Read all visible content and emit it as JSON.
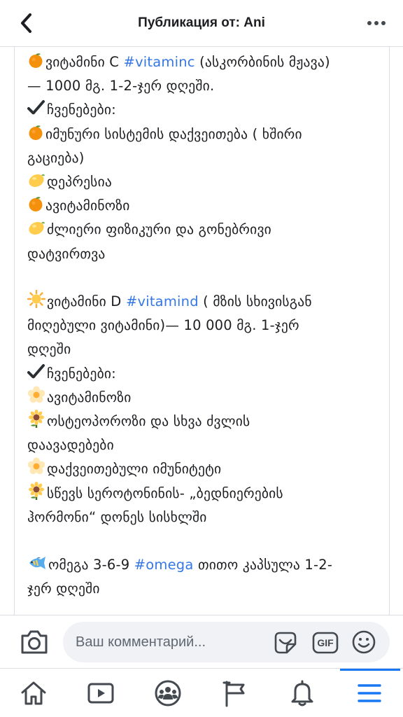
{
  "header": {
    "title": "Публикация от: Ani",
    "back_icon": "chevron-left-icon",
    "more_icon": "more-horizontal-icon"
  },
  "post": {
    "lines": [
      {
        "emoji": "orange",
        "parts": [
          {
            "text": "ვიტამინი C "
          },
          {
            "text": "#vitaminc",
            "tag": true
          },
          {
            "text": " (ასკორბინის მჟავა)"
          }
        ]
      },
      {
        "parts": [
          {
            "text": "— 1000 მგ. 1-2-ჯერ დღეში."
          }
        ]
      },
      {
        "emoji": "check",
        "parts": [
          {
            "text": "ჩვენებები:"
          }
        ]
      },
      {
        "emoji": "orange",
        "parts": [
          {
            "text": "იმუნური სისტემის დაქვეითება ( ხშირი"
          }
        ]
      },
      {
        "parts": [
          {
            "text": "გაციება)"
          }
        ]
      },
      {
        "emoji": "lemon",
        "parts": [
          {
            "text": "დეპრესია"
          }
        ]
      },
      {
        "emoji": "orange",
        "parts": [
          {
            "text": "ავიტამინოზი"
          }
        ]
      },
      {
        "emoji": "lemon",
        "parts": [
          {
            "text": "ძლიერი ფიზიკური და გონებრივი"
          }
        ]
      },
      {
        "parts": [
          {
            "text": "დატვირთვა"
          }
        ]
      },
      {
        "blank": true
      },
      {
        "emoji": "sun",
        "parts": [
          {
            "text": "ვიტამინი D "
          },
          {
            "text": "#vitamind",
            "tag": true
          },
          {
            "text": " ( მზის სხივისგან"
          }
        ]
      },
      {
        "parts": [
          {
            "text": "მიღებული ვიტამინი)— 10 000 მგ. 1-ჯერ"
          }
        ]
      },
      {
        "parts": [
          {
            "text": "დღეში"
          }
        ]
      },
      {
        "emoji": "check",
        "parts": [
          {
            "text": "ჩვენებები:"
          }
        ]
      },
      {
        "emoji": "blossom",
        "parts": [
          {
            "text": "ავიტამინოზი"
          }
        ]
      },
      {
        "emoji": "sunflower",
        "parts": [
          {
            "text": "ოსტეოპოროზი და სხვა ძვლის"
          }
        ]
      },
      {
        "parts": [
          {
            "text": "დაავადებები"
          }
        ]
      },
      {
        "emoji": "blossom",
        "parts": [
          {
            "text": "დაქვეითებული იმუნიტეტი"
          }
        ]
      },
      {
        "emoji": "sunflower",
        "parts": [
          {
            "text": "სწევს სეროტონინის- „ბედნიერების"
          }
        ]
      },
      {
        "parts": [
          {
            "text": "ჰორმონი“ დონეს სისხლში"
          }
        ]
      },
      {
        "blank": true
      },
      {
        "emoji": "fish",
        "parts": [
          {
            "text": "ომეგა 3-6-9 "
          },
          {
            "text": "#omega",
            "tag": true
          },
          {
            "text": " თითო კაპსულა 1-2-"
          }
        ]
      },
      {
        "parts": [
          {
            "text": "ჯერ დღეში"
          }
        ]
      }
    ]
  },
  "comment": {
    "placeholder": "Ваш комментарий...",
    "camera_icon": "camera-icon",
    "sticker_icon": "sticker-icon",
    "gif_label": "GIF",
    "emoji_icon": "smiley-icon"
  },
  "nav": {
    "items": [
      "home-icon",
      "video-icon",
      "groups-icon",
      "pages-flag-icon",
      "notifications-bell-icon",
      "menu-icon"
    ],
    "active": "menu-icon"
  },
  "colors": {
    "hashtag": "#3578e5",
    "active_tab": "#1877f2",
    "icon": "#444950"
  }
}
